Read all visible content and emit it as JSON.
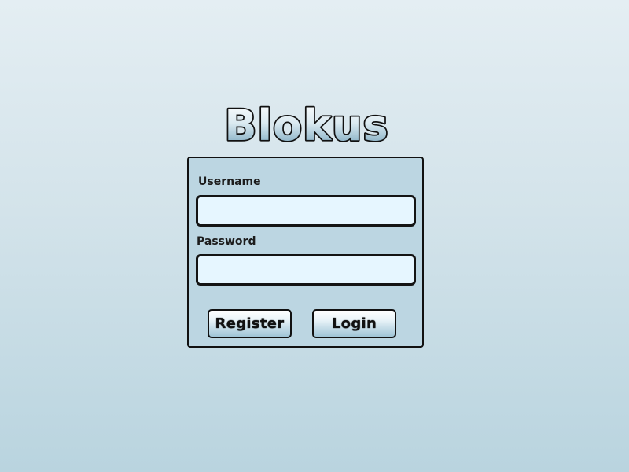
{
  "app": {
    "logo_text": "Blokus"
  },
  "login_form": {
    "username_label": "Username",
    "username_value": "",
    "password_label": "Password",
    "password_value": "",
    "register_label": "Register",
    "login_label": "Login"
  },
  "colors": {
    "background_top": "#e4eef3",
    "background_bottom": "#b9d4df",
    "panel": "#bcd6e2",
    "input": "#e6f6ff",
    "border": "#111111"
  }
}
